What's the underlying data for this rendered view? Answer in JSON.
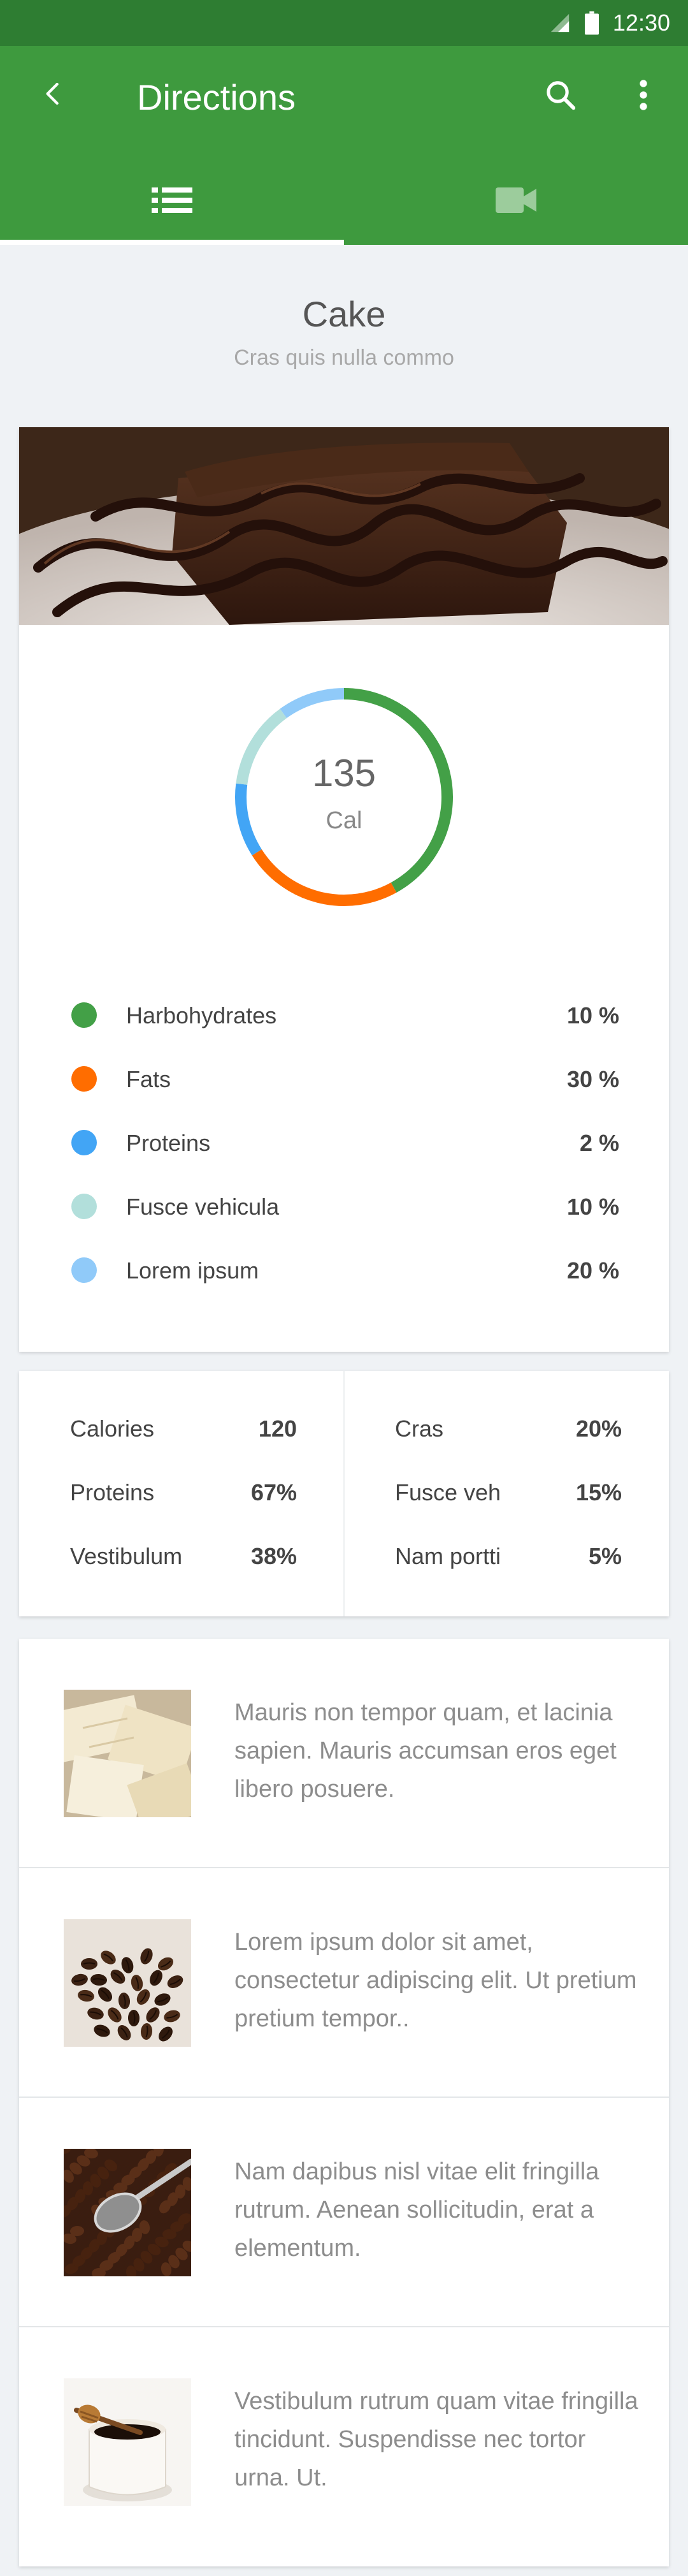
{
  "status_bar": {
    "time": "12:30"
  },
  "app_bar": {
    "title": "Directions",
    "tabs": [
      {
        "icon": "list-icon",
        "active": true
      },
      {
        "icon": "videocam-icon",
        "active": false
      }
    ]
  },
  "recipe": {
    "title": "Cake",
    "subtitle": "Cras quis nulla commo"
  },
  "nutrition": {
    "total_value": "135",
    "unit": "Cal",
    "legend": [
      {
        "label": "Harbohydrates",
        "percent": "10 %",
        "color": "#43a047"
      },
      {
        "label": "Fats",
        "percent": "30 %",
        "color": "#ff6d00"
      },
      {
        "label": "Proteins",
        "percent": "2 %",
        "color": "#42a5f5"
      },
      {
        "label": "Fusce vehicula",
        "percent": "10 %",
        "color": "#b2dfdb"
      },
      {
        "label": "Lorem ipsum",
        "percent": "20 %",
        "color": "#90caf9"
      }
    ],
    "ring_segments": [
      {
        "color": "#43a047",
        "fraction": 0.42
      },
      {
        "color": "#ff6d00",
        "fraction": 0.24
      },
      {
        "color": "#42a5f5",
        "fraction": 0.11
      },
      {
        "color": "#b2dfdb",
        "fraction": 0.13
      },
      {
        "color": "#90caf9",
        "fraction": 0.1
      }
    ]
  },
  "stats": {
    "left": [
      {
        "label": "Calories",
        "value": "120"
      },
      {
        "label": "Proteins",
        "value": "67%"
      },
      {
        "label": "Vestibulum",
        "value": "38%"
      }
    ],
    "right": [
      {
        "label": "Cras",
        "value": "20%"
      },
      {
        "label": "Fusce veh",
        "value": "15%"
      },
      {
        "label": "Nam portti",
        "value": "5%"
      }
    ]
  },
  "items": [
    {
      "text": "Mauris non tempor quam, et lacinia sapien. Mauris accumsan eros eget libero posuere.",
      "image": "white-chocolate"
    },
    {
      "text": "Lorem ipsum dolor sit amet, consectetur adipiscing elit. Ut pretium pretium tempor..",
      "image": "coffee-beans"
    },
    {
      "text": "Nam dapibus nisl vitae elit fringilla rutrum. Aenean sollicitudin, erat a elementum.",
      "image": "coffee-scoop"
    },
    {
      "text": "Vestibulum rutrum quam vitae fringilla tincidunt. Suspendisse nec tortor urna. Ut.",
      "image": "honey-jar"
    }
  ]
}
